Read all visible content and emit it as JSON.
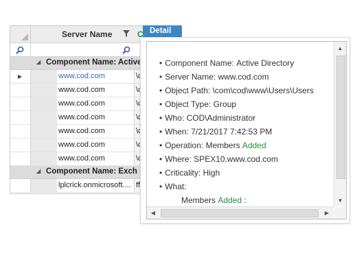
{
  "grid": {
    "column_header": "Server Name",
    "column2_header_fragment": "C",
    "groups": [
      {
        "label": "Component Name: Active",
        "rows": [
          {
            "server": "www.cod.com",
            "col2": "\\c",
            "selected": true
          },
          {
            "server": "www.cod.com",
            "col2": "\\c",
            "selected": false
          },
          {
            "server": "www.cod.com",
            "col2": "\\c",
            "selected": false
          },
          {
            "server": "www.cod.com",
            "col2": "\\c",
            "selected": false
          },
          {
            "server": "www.cod.com",
            "col2": "\\c",
            "selected": false
          },
          {
            "server": "www.cod.com",
            "col2": "\\c",
            "selected": false
          },
          {
            "server": "www.cod.com",
            "col2": "\\c",
            "selected": false
          }
        ]
      },
      {
        "label": "Component Name: Exch",
        "rows": [
          {
            "server": "lplcrick.onmicrosoft....",
            "col2": "fff",
            "selected": false
          }
        ]
      }
    ]
  },
  "detail": {
    "tab_label": "Detail",
    "fields": [
      {
        "label": "Component Name:",
        "value": "Active Directory"
      },
      {
        "label": "Server Name:",
        "value": "www.cod.com"
      },
      {
        "label": "Object Path:",
        "value": "\\com\\cod\\www\\Users\\Users"
      },
      {
        "label": "Object Type:",
        "value": "Group"
      },
      {
        "label": "Who:",
        "value": "COD\\Administrator"
      },
      {
        "label": "When:",
        "value": "7/21/2017 7:42:53 PM"
      },
      {
        "label": "Operation:",
        "value": "Members",
        "highlight": "Added"
      },
      {
        "label": "Where:",
        "value": "SPEX10.www.cod.com"
      },
      {
        "label": "Criticality:",
        "value": "High"
      },
      {
        "label": "What:",
        "value": ""
      }
    ],
    "what_detail": {
      "label": "Members",
      "highlight": "Added",
      "suffix": ":"
    },
    "highlight_color": "#2e8b3a"
  },
  "colors": {
    "tab_bg": "#3d86c6",
    "link": "#3a68b0"
  }
}
